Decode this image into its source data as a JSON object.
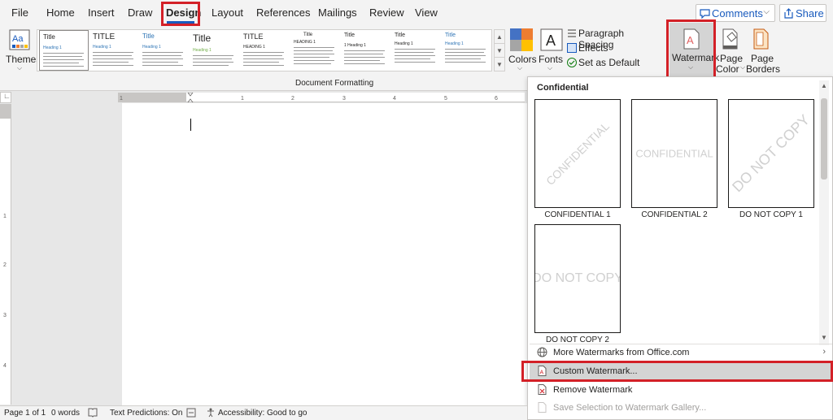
{
  "tabs": [
    "File",
    "Home",
    "Insert",
    "Draw",
    "Design",
    "Layout",
    "References",
    "Mailings",
    "Review",
    "View"
  ],
  "active_tab": "Design",
  "comments_label": "Comments",
  "share_label": "Share",
  "ribbon": {
    "themes_label": "Themes",
    "colors_label": "Colors",
    "fonts_label": "Fonts",
    "paragraph_spacing_label": "Paragraph Spacing",
    "effects_label": "Effects",
    "set_default_label": "Set as Default",
    "watermark_label": "Watermark",
    "page_color_line1": "Page",
    "page_color_line2": "Color",
    "page_borders_line1": "Page",
    "page_borders_line2": "Borders",
    "group_label": "Document Formatting",
    "style_gallery": [
      {
        "title": "Title",
        "heading": "Heading 1"
      },
      {
        "title": "TITLE",
        "heading": "Heading 1"
      },
      {
        "title": "Title",
        "heading": "Heading 1"
      },
      {
        "title": "Title",
        "heading": "Heading 1"
      },
      {
        "title": "TITLE",
        "heading": "HEADING 1"
      },
      {
        "title": "Title",
        "heading": "HEADING 1"
      },
      {
        "title": "Title",
        "heading": "1 Heading 1"
      },
      {
        "title": "Title",
        "heading": "Heading 1"
      },
      {
        "title": "Title",
        "heading": "Heading 1"
      }
    ]
  },
  "watermark_menu": {
    "section_header": "Confidential",
    "items": [
      {
        "caption": "CONFIDENTIAL 1",
        "text": "CONFIDENTIAL",
        "diagonal": true
      },
      {
        "caption": "CONFIDENTIAL 2",
        "text": "CONFIDENTIAL",
        "diagonal": false
      },
      {
        "caption": "DO NOT COPY 1",
        "text": "DO NOT COPY",
        "diagonal": true
      },
      {
        "caption": "DO NOT COPY 2",
        "text": "DO NOT COPY",
        "diagonal": false
      }
    ],
    "more_label": "More Watermarks from Office.com",
    "custom_label": "Custom Watermark...",
    "remove_label": "Remove Watermark",
    "save_selection_label": "Save Selection to Watermark Gallery..."
  },
  "status_bar": {
    "page": "Page 1 of 1",
    "words": "0 words",
    "text_predictions": "Text Predictions: On",
    "accessibility": "Accessibility: Good to go"
  },
  "colors": {
    "accent": "#185abd",
    "highlight_box": "#d32027"
  }
}
